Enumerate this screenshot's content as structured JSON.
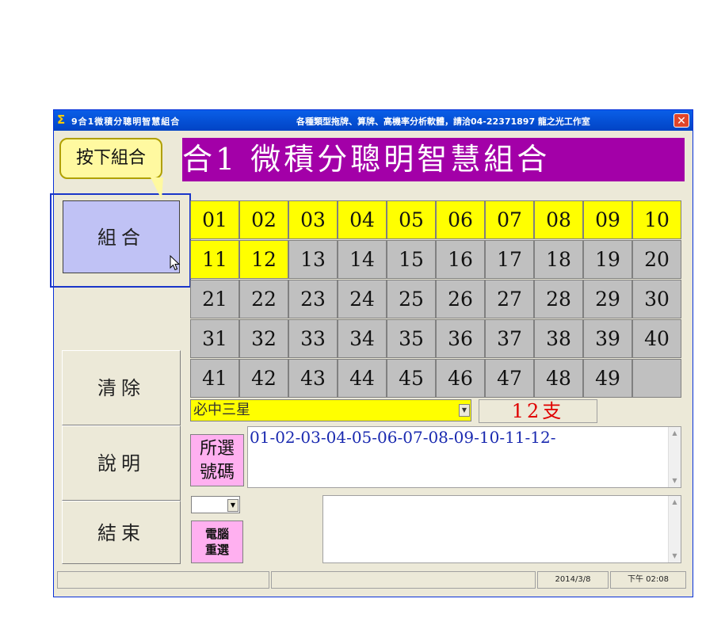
{
  "window": {
    "title": "9合1微積分聰明智慧組合",
    "title_extra": "各種類型拖牌、算牌、高機率分析軟體，請洽04-22371897 龍之光工作室",
    "close_glyph": "✕"
  },
  "banner": {
    "text": "合1 微積分聰明智慧組合"
  },
  "tooltip": {
    "text": "按下組合"
  },
  "left_buttons": {
    "combine": "組合",
    "clear": "清除",
    "explain": "說明",
    "exit": "結束"
  },
  "number_grid": {
    "rows": [
      [
        "01",
        "02",
        "03",
        "04",
        "05",
        "06",
        "07",
        "08",
        "09",
        "10"
      ],
      [
        "11",
        "12",
        "13",
        "14",
        "15",
        "16",
        "17",
        "18",
        "19",
        "20"
      ],
      [
        "21",
        "22",
        "23",
        "24",
        "25",
        "26",
        "27",
        "28",
        "29",
        "30"
      ],
      [
        "31",
        "32",
        "33",
        "34",
        "35",
        "36",
        "37",
        "38",
        "39",
        "40"
      ],
      [
        "41",
        "42",
        "43",
        "44",
        "45",
        "46",
        "47",
        "48",
        "49",
        ""
      ]
    ],
    "selected": [
      "01",
      "02",
      "03",
      "04",
      "05",
      "06",
      "07",
      "08",
      "09",
      "10",
      "11",
      "12"
    ]
  },
  "mode_select": {
    "value": "必中三星"
  },
  "count": {
    "text": "12支"
  },
  "selected_numbers": {
    "label_line1": "所選",
    "label_line2": "號碼",
    "value": "01-02-03-04-05-06-07-08-09-10-11-12-"
  },
  "computer_reselect": {
    "line1": "電腦",
    "line2": "重選"
  },
  "status": {
    "date": "2014/3/8",
    "time": "下午 02:08"
  },
  "colors": {
    "selected_cell": "#ffff00",
    "unselected_cell": "#c0c0c0",
    "banner_bg": "#a300a8",
    "combine_button_bg": "#c0c2f5",
    "label_pink": "#ffb0f0",
    "count_red": "#e00000"
  },
  "icons": {
    "app_icon": "sigma-icon",
    "cursor": "mouse-pointer-icon"
  }
}
